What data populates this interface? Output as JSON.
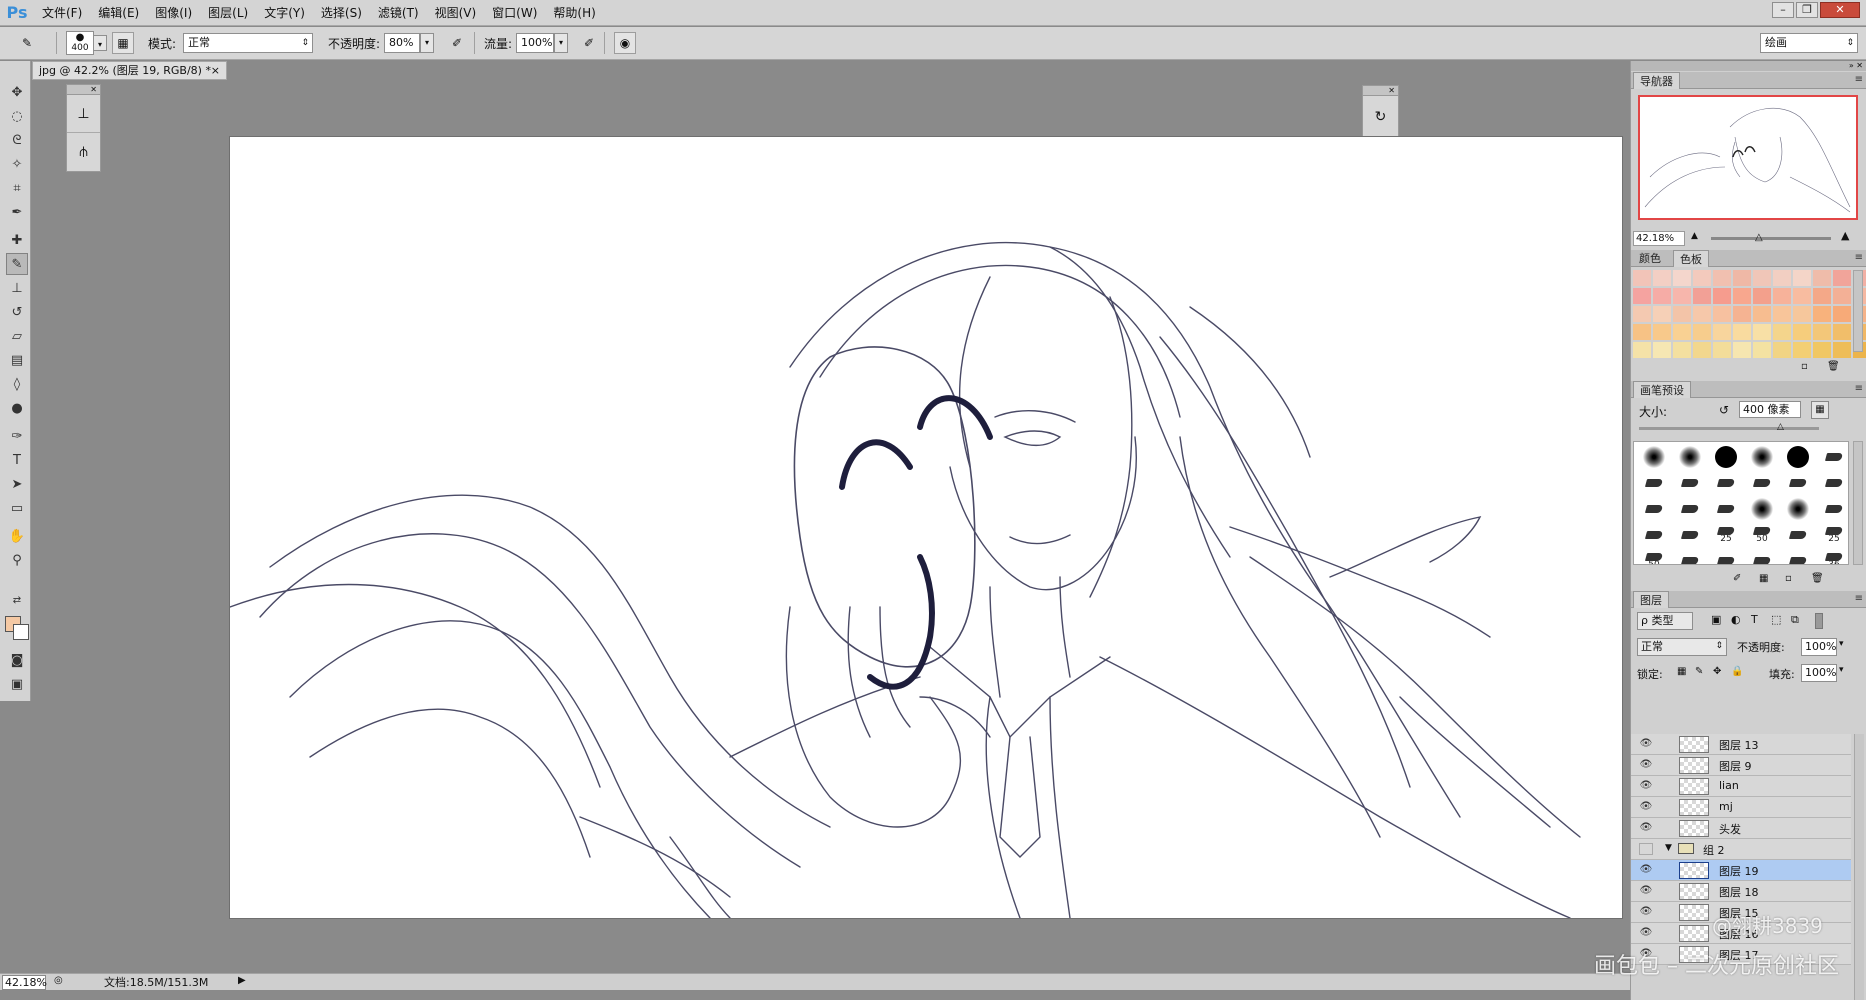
{
  "app": {
    "logo": "Ps"
  },
  "menu": [
    "文件(F)",
    "编辑(E)",
    "图像(I)",
    "图层(L)",
    "文字(Y)",
    "选择(S)",
    "滤镜(T)",
    "视图(V)",
    "窗口(W)",
    "帮助(H)"
  ],
  "window_controls": {
    "minimize": "–",
    "restore": "❐",
    "close": "✕"
  },
  "options": {
    "brush_size": "400",
    "mode_label": "模式:",
    "mode_value": "正常",
    "opacity_label": "不透明度:",
    "opacity_value": "80%",
    "flow_label": "流量:",
    "flow_value": "100%",
    "workspace": "绘画"
  },
  "document": {
    "tab_title": "jpg @ 42.2% (图层 19, RGB/8) *",
    "tab_close": "×"
  },
  "status": {
    "zoom": "42.18%",
    "doc_size": "文档:18.5M/151.3M",
    "arrow": "▶"
  },
  "panels": {
    "navigator": {
      "tab": "导航器",
      "zoom": "42.18%"
    },
    "color_tabs": {
      "color": "颜色",
      "swatches": "色板"
    },
    "swatch_colors": [
      "#f2c4b8",
      "#f3cfc4",
      "#f4d6cc",
      "#f3cabd",
      "#f1c0b0",
      "#efb8a6",
      "#f0c6b8",
      "#f2cfc2",
      "#f4d5c8",
      "#efbcaa",
      "#f1a49a",
      "#f2b0a5",
      "#f5a3a0",
      "#f6aca6",
      "#f7b6ac",
      "#f2a096",
      "#f69c8e",
      "#f8a78e",
      "#f3a08c",
      "#f7b29a",
      "#f8bca0",
      "#f4a888",
      "#f3b096",
      "#f5b8a2",
      "#f4c9b1",
      "#f6d0b7",
      "#f3c4a8",
      "#f6c8aa",
      "#f7c1a0",
      "#f5b392",
      "#f7bd90",
      "#f8c59a",
      "#f6c79c",
      "#f8b27c",
      "#f7aa78",
      "#f5b38a",
      "#f7c285",
      "#f8c98b",
      "#f9d193",
      "#f7cd8d",
      "#f8d59d",
      "#f9db9f",
      "#f8e0a6",
      "#f4d58c",
      "#f6cd7c",
      "#f3c779",
      "#f1be6a",
      "#f0b866",
      "#f5e2a8",
      "#f6e7b3",
      "#f4e0a0",
      "#f2d78e",
      "#f3dd9a",
      "#f6e6b0",
      "#f4e2a2",
      "#f1d484",
      "#f3cf74",
      "#f0c764",
      "#eebd58",
      "#ecb44c"
    ],
    "brush_presets": {
      "tab": "画笔预设",
      "size_label": "大小:",
      "size_value": "400 像素",
      "brushes": [
        {
          "kind": "soft",
          "label": ""
        },
        {
          "kind": "soft",
          "label": ""
        },
        {
          "kind": "hard",
          "label": ""
        },
        {
          "kind": "soft",
          "label": ""
        },
        {
          "kind": "hard",
          "label": ""
        },
        {
          "kind": "tip",
          "label": ""
        },
        {
          "kind": "tip",
          "label": ""
        },
        {
          "kind": "tip",
          "label": ""
        },
        {
          "kind": "tip",
          "label": ""
        },
        {
          "kind": "tip",
          "label": ""
        },
        {
          "kind": "tip",
          "label": ""
        },
        {
          "kind": "tip",
          "label": ""
        },
        {
          "kind": "tip",
          "label": ""
        },
        {
          "kind": "tip",
          "label": ""
        },
        {
          "kind": "tip",
          "label": ""
        },
        {
          "kind": "soft",
          "label": ""
        },
        {
          "kind": "soft",
          "label": ""
        },
        {
          "kind": "tip",
          "label": ""
        },
        {
          "kind": "tip",
          "label": ""
        },
        {
          "kind": "tip",
          "label": ""
        },
        {
          "kind": "tip",
          "label": "25"
        },
        {
          "kind": "tip",
          "label": "50"
        },
        {
          "kind": "tip",
          "label": ""
        },
        {
          "kind": "tip",
          "label": "25"
        },
        {
          "kind": "tip",
          "label": "50"
        },
        {
          "kind": "tip",
          "label": ""
        },
        {
          "kind": "tip",
          "label": ""
        },
        {
          "kind": "tip",
          "label": ""
        },
        {
          "kind": "tip",
          "label": ""
        },
        {
          "kind": "tip",
          "label": "36"
        }
      ]
    },
    "layers": {
      "tab": "图层",
      "filter": "ρ 类型",
      "blend_mode": "正常",
      "opacity_label": "不透明度:",
      "opacity_value": "100%",
      "lock_label": "锁定:",
      "fill_label": "填充:",
      "fill_value": "100%",
      "rows": [
        {
          "name": "图层 13",
          "type": "layer",
          "visible": true,
          "selected": false
        },
        {
          "name": "图层 9",
          "type": "layer",
          "visible": true,
          "selected": false
        },
        {
          "name": "lian",
          "type": "layer",
          "visible": true,
          "selected": false
        },
        {
          "name": "mj",
          "type": "layer",
          "visible": true,
          "selected": false
        },
        {
          "name": "头发",
          "type": "layer",
          "visible": true,
          "selected": false
        },
        {
          "name": "组 2",
          "type": "group",
          "visible": false,
          "selected": false
        },
        {
          "name": "图层 19",
          "type": "layer",
          "visible": true,
          "selected": true
        },
        {
          "name": "图层 18",
          "type": "layer",
          "visible": true,
          "selected": false
        },
        {
          "name": "图层 15",
          "type": "layer",
          "visible": true,
          "selected": false
        },
        {
          "name": "图层 16",
          "type": "layer",
          "visible": true,
          "selected": false
        },
        {
          "name": "图层 17",
          "type": "layer",
          "visible": true,
          "selected": false
        }
      ]
    }
  },
  "watermark": {
    "line1": "@翎耕3839",
    "line2": "画包包 – 二次元原创社区"
  }
}
